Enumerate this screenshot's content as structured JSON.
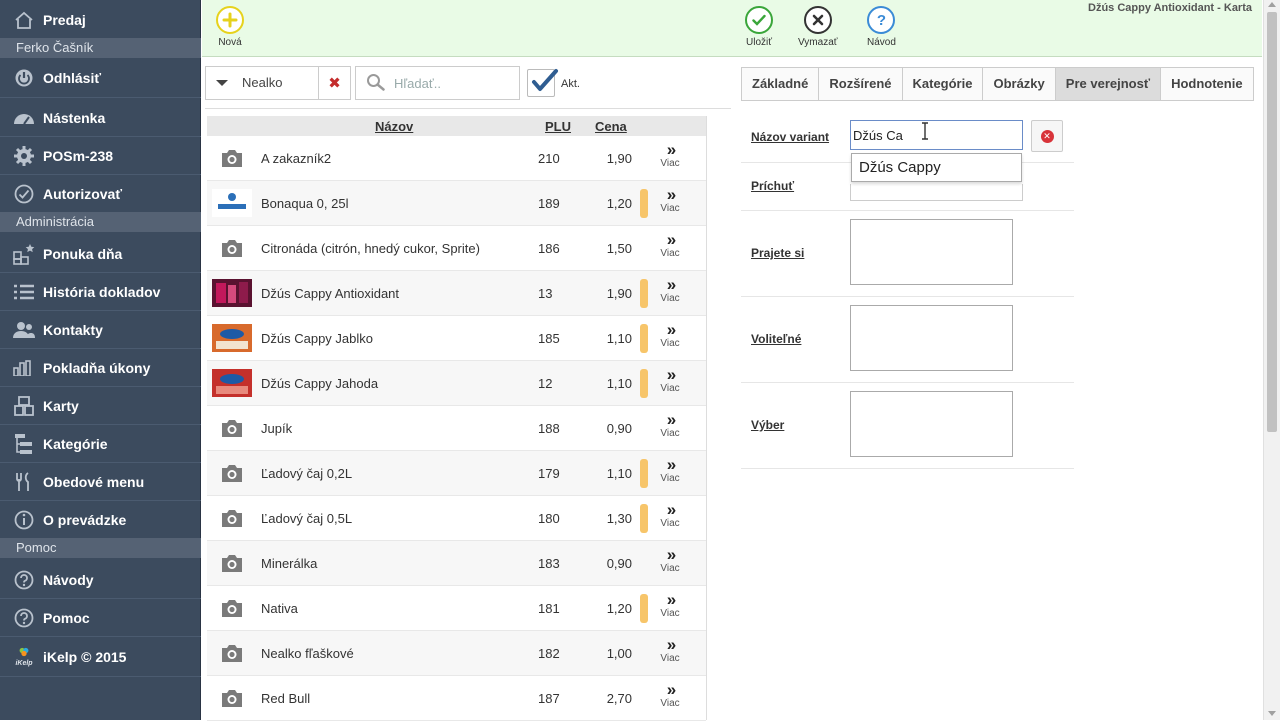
{
  "sidebar": {
    "items": [
      {
        "label": "Predaj",
        "icon": "home-icon"
      },
      {
        "label": "Odhlásiť",
        "icon": "power-icon"
      },
      {
        "label": "Nástenka",
        "icon": "dashboard-icon"
      },
      {
        "label": "POSm-238",
        "icon": "gear-icon"
      },
      {
        "label": "Autorizovať",
        "icon": "check-circle-icon"
      },
      {
        "label": "Ponuka dňa",
        "icon": "daily-offer-icon"
      },
      {
        "label": "História dokladov",
        "icon": "list-icon"
      },
      {
        "label": "Kontakty",
        "icon": "contacts-icon"
      },
      {
        "label": "Pokladňa úkony",
        "icon": "bar-chart-icon"
      },
      {
        "label": "Karty",
        "icon": "cards-icon"
      },
      {
        "label": "Kategórie",
        "icon": "tree-icon"
      },
      {
        "label": "Obedové menu",
        "icon": "fork-knife-icon"
      },
      {
        "label": "O prevádzke",
        "icon": "info-icon"
      },
      {
        "label": "Návody",
        "icon": "help-icon"
      },
      {
        "label": "Pomoc",
        "icon": "help-icon"
      },
      {
        "label": "iKelp © 2015",
        "icon": "ikelp-logo"
      }
    ],
    "sections": [
      "Ferko Čašník",
      "Administrácia",
      "Pomoc"
    ],
    "logo_caption": "iKelp"
  },
  "toolbar": {
    "new_label": "Nová",
    "save_label": "Uložiť",
    "delete_label": "Vymazať",
    "help_label": "Návod",
    "window_title": "Džús Cappy Antioxidant - Karta",
    "colors": {
      "new": "#e6d21c",
      "save": "#3aa63a",
      "delete": "#333333",
      "help": "#3a8bd6"
    }
  },
  "filter": {
    "category_value": "Nealko",
    "clear_icon": "✖",
    "search_placeholder": "Hľadať..",
    "active_label": "Akt.",
    "active_checked": true
  },
  "table": {
    "headers": {
      "name": "Názov",
      "plu": "PLU",
      "price": "Cena"
    },
    "more_label": "Viac",
    "more_glyph": "»",
    "rows": [
      {
        "name": "A zakazník2",
        "plu": "210",
        "price": "1,90",
        "flag": false,
        "thumb": "camera"
      },
      {
        "name": "Bonaqua 0, 25l",
        "plu": "189",
        "price": "1,20",
        "flag": true,
        "thumb": "bonaqua"
      },
      {
        "name": "Citronáda (citrón, hnedý cukor, Sprite)",
        "plu": "186",
        "price": "1,50",
        "flag": false,
        "thumb": "camera"
      },
      {
        "name": "Džús Cappy Antioxidant",
        "plu": "13",
        "price": "1,90",
        "flag": true,
        "thumb": "cappy-dark"
      },
      {
        "name": "Džús Cappy Jablko",
        "plu": "185",
        "price": "1,10",
        "flag": true,
        "thumb": "cappy"
      },
      {
        "name": "Džús Cappy Jahoda",
        "plu": "12",
        "price": "1,10",
        "flag": true,
        "thumb": "cappy-red"
      },
      {
        "name": "Jupík",
        "plu": "188",
        "price": "0,90",
        "flag": false,
        "thumb": "camera"
      },
      {
        "name": "Ľadový čaj 0,2L",
        "plu": "179",
        "price": "1,10",
        "flag": true,
        "thumb": "camera"
      },
      {
        "name": "Ľadový čaj 0,5L",
        "plu": "180",
        "price": "1,30",
        "flag": true,
        "thumb": "camera"
      },
      {
        "name": "Minerálka",
        "plu": "183",
        "price": "0,90",
        "flag": false,
        "thumb": "camera"
      },
      {
        "name": "Nativa",
        "plu": "181",
        "price": "1,20",
        "flag": true,
        "thumb": "camera"
      },
      {
        "name": "Nealko fľaškové",
        "plu": "182",
        "price": "1,00",
        "flag": false,
        "thumb": "camera"
      },
      {
        "name": "Red Bull",
        "plu": "187",
        "price": "2,70",
        "flag": false,
        "thumb": "camera"
      }
    ]
  },
  "tabs": [
    {
      "label": "Základné",
      "active": false
    },
    {
      "label": "Rozšírené",
      "active": false
    },
    {
      "label": "Kategórie",
      "active": false
    },
    {
      "label": "Obrázky",
      "active": false
    },
    {
      "label": "Pre verejnosť",
      "active": true
    },
    {
      "label": "Hodnotenie",
      "active": false
    }
  ],
  "form": {
    "variant_label": "Názov variant",
    "variant_value": "Džús Ca",
    "suggestion": "Džús Cappy",
    "flavor_label": "Príchuť",
    "wish_label": "Prajete si",
    "optional_label": "Voliteľné",
    "choice_label": "Výber",
    "clear_glyph": "✕"
  }
}
